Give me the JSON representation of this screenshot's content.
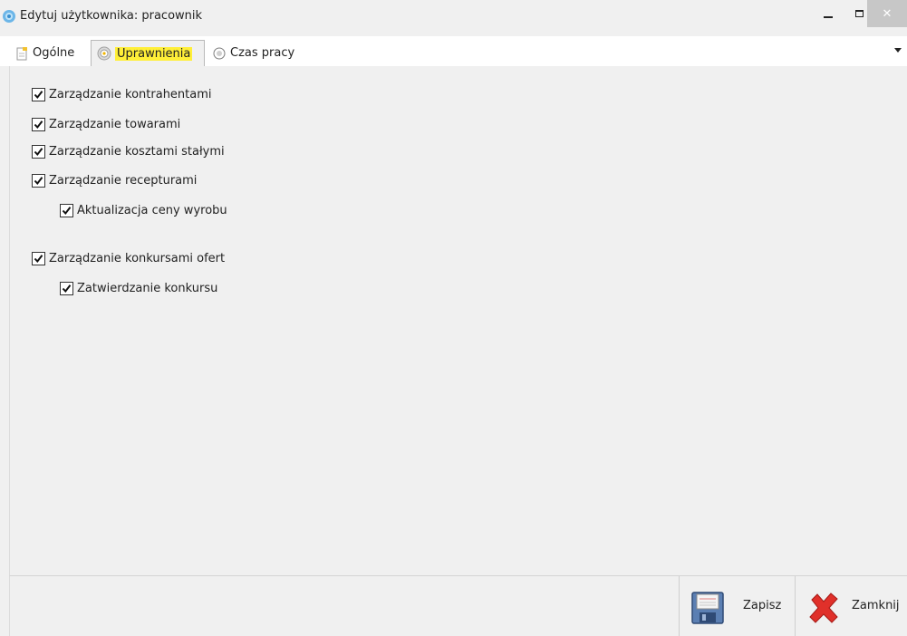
{
  "window": {
    "title": "Edytuj użytkownika: pracownik"
  },
  "tabs": [
    {
      "label": "Ogólne",
      "icon": "document-icon",
      "active": false
    },
    {
      "label": "Uprawnienia",
      "icon": "gear-icon",
      "active": true
    },
    {
      "label": "Czas pracy",
      "icon": "radio-icon",
      "active": false
    }
  ],
  "permissions": [
    {
      "label": "Zarządzanie kontrahentami",
      "checked": true,
      "level": 0
    },
    {
      "label": "Zarządzanie towarami",
      "checked": true,
      "level": 0
    },
    {
      "label": "Zarządzanie kosztami stałymi",
      "checked": true,
      "level": 0
    },
    {
      "label": "Zarządzanie recepturami",
      "checked": true,
      "level": 0
    },
    {
      "label": "Aktualizacja ceny wyrobu",
      "checked": true,
      "level": 1
    },
    {
      "label": "Zarządzanie konkursami ofert",
      "checked": true,
      "level": 0
    },
    {
      "label": "Zatwierdzanie konkursu",
      "checked": true,
      "level": 1
    }
  ],
  "footer": {
    "save_label": "Zapisz",
    "close_label": "Zamknij"
  },
  "colors": {
    "highlight": "#ffef38",
    "close_red": "#e0302a",
    "floppy_blue": "#4a6fa5"
  }
}
